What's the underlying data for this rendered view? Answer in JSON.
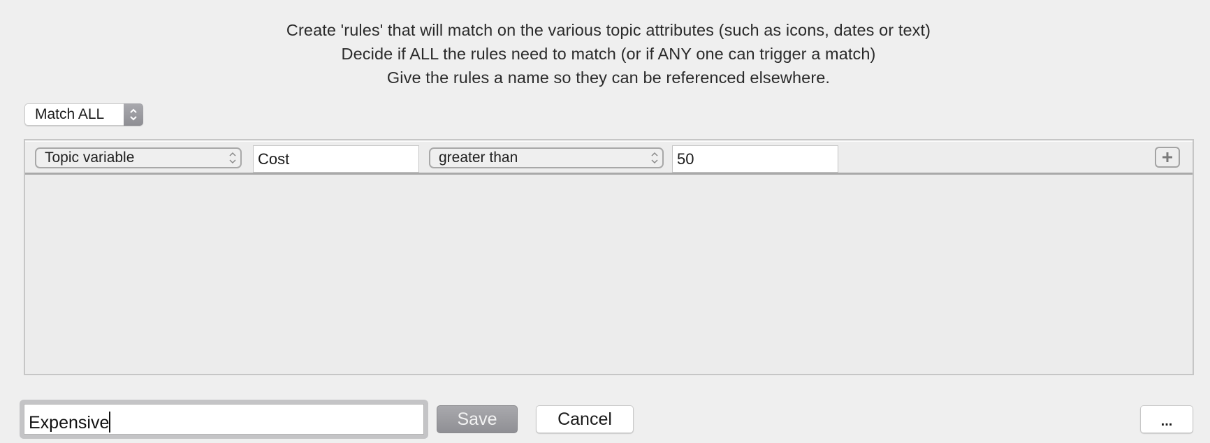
{
  "instructions": [
    "Create 'rules' that will match on the various topic attributes (such as icons, dates or text)",
    "Decide if ALL the rules need to match (or if ANY one can trigger a match)",
    "Give the rules a name so they can be referenced elsewhere."
  ],
  "match_mode": {
    "selected": "Match ALL",
    "icon": "up-down-chevron-icon"
  },
  "rules": [
    {
      "attribute": "Topic variable",
      "variable_name": "Cost",
      "operator": "greater than",
      "value": "50",
      "add_icon": "plus-icon"
    }
  ],
  "footer": {
    "rule_name_value": "Expensive",
    "save_label": "Save",
    "cancel_label": "Cancel",
    "more_label": "..."
  },
  "colors": {
    "background": "#efefef",
    "panel_border": "#c6c6c6",
    "disabled_button": "#98989c"
  }
}
